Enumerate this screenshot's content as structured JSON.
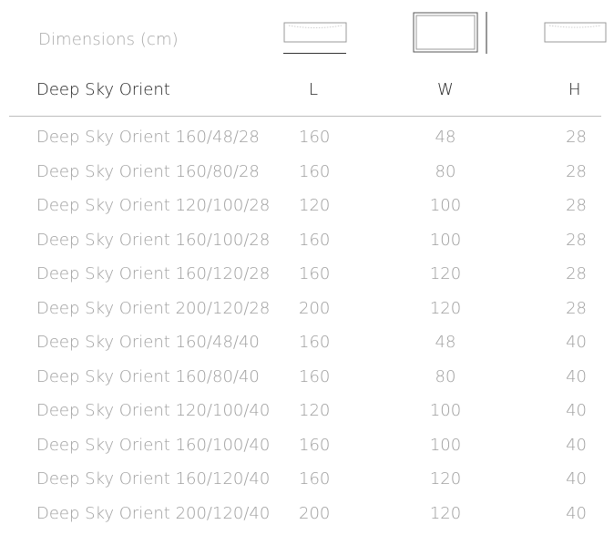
{
  "section": {
    "title": "Dimensions (cm)"
  },
  "view_icons": [
    {
      "name": "front-view-icon",
      "active": true
    },
    {
      "name": "top-view-icon",
      "active": false
    },
    {
      "name": "side-view-icon",
      "active": false
    }
  ],
  "table": {
    "headers": {
      "name": "Deep Sky Orient",
      "l": "L",
      "w": "W",
      "h": "H"
    },
    "rows": [
      {
        "name": "Deep Sky Orient 160/48/28",
        "l": "160",
        "w": "48",
        "h": "28"
      },
      {
        "name": "Deep Sky Orient 160/80/28",
        "l": "160",
        "w": "80",
        "h": "28"
      },
      {
        "name": "Deep Sky Orient 120/100/28",
        "l": "120",
        "w": "100",
        "h": "28"
      },
      {
        "name": "Deep Sky Orient 160/100/28",
        "l": "160",
        "w": "100",
        "h": "28"
      },
      {
        "name": "Deep Sky Orient 160/120/28",
        "l": "160",
        "w": "120",
        "h": "28"
      },
      {
        "name": "Deep Sky Orient 200/120/28",
        "l": "200",
        "w": "120",
        "h": "28"
      },
      {
        "name": "Deep Sky Orient 160/48/40",
        "l": "160",
        "w": "48",
        "h": "40"
      },
      {
        "name": "Deep Sky Orient 160/80/40",
        "l": "160",
        "w": "80",
        "h": "40"
      },
      {
        "name": "Deep Sky Orient 120/100/40",
        "l": "120",
        "w": "100",
        "h": "40"
      },
      {
        "name": "Deep Sky Orient 160/100/40",
        "l": "160",
        "w": "100",
        "h": "40"
      },
      {
        "name": "Deep Sky Orient 160/120/40",
        "l": "160",
        "w": "120",
        "h": "40"
      },
      {
        "name": "Deep Sky Orient 200/120/40",
        "l": "200",
        "w": "120",
        "h": "40"
      }
    ]
  }
}
